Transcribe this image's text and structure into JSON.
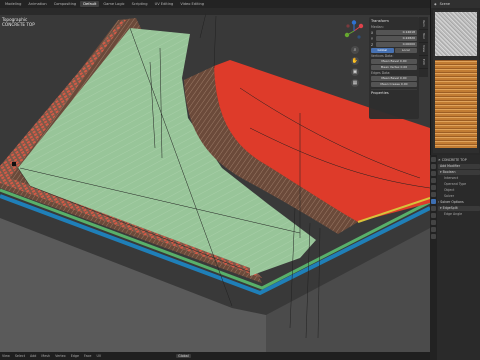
{
  "top_tabs": [
    "Modeling",
    "Animation",
    "Compositing",
    "Default",
    "Game Logic",
    "Scripting",
    "UV Editing",
    "Video Editing"
  ],
  "active_tab": "Default",
  "viewport": {
    "mode_label": "Topographic",
    "object_label": "CONCRETE TOP"
  },
  "n_panel": {
    "header": "Transform",
    "median_label": "Median:",
    "axes": [
      {
        "axis": "X",
        "value": "0.14618"
      },
      {
        "axis": "Y",
        "value": "0.22820"
      },
      {
        "axis": "Z",
        "value": "0.00000"
      }
    ],
    "global_label": "Global",
    "local_label": "Local",
    "vertex_data_label": "Vertices Data:",
    "mean_bevel_label": "Mean Bevel",
    "mean_bevel_value": "0.00",
    "mean_vertex_label": "Mean Vertex",
    "mean_vertex_value": "0.00",
    "edges_data_label": "Edges Data:",
    "mean_bevel2_label": "Mean Bevel",
    "mean_bevel2_value": "0.00",
    "mean_crease_label": "Mean Crease",
    "mean_crease_value": "0.00",
    "properties_label": "Properties"
  },
  "side_tabs": [
    "Item",
    "Tool",
    "View",
    "Edit"
  ],
  "right_header": {
    "label": "Scene"
  },
  "properties": {
    "object_name": "CONCRETE TOP",
    "add_modifier": "Add Modifier",
    "modifier1": "Boolean",
    "intersect": "Intersect",
    "operand_type": "Operand Type",
    "object": "Object",
    "solver": "Solver",
    "solver_options": "Solver Options",
    "modifier2": "EdgeSplit",
    "edge_angle": "Edge Angle"
  },
  "status_bar": {
    "items": [
      "View",
      "Select",
      "Add",
      "Mesh",
      "Vertex",
      "Edge",
      "Face",
      "UV"
    ],
    "global": "Global"
  },
  "colors": {
    "red_face": "#de3b2a",
    "green_face": "#98c599",
    "wood_face": "#6b4a3a",
    "blue_edge": "#1f7fb8",
    "accent": "#4772b3"
  }
}
